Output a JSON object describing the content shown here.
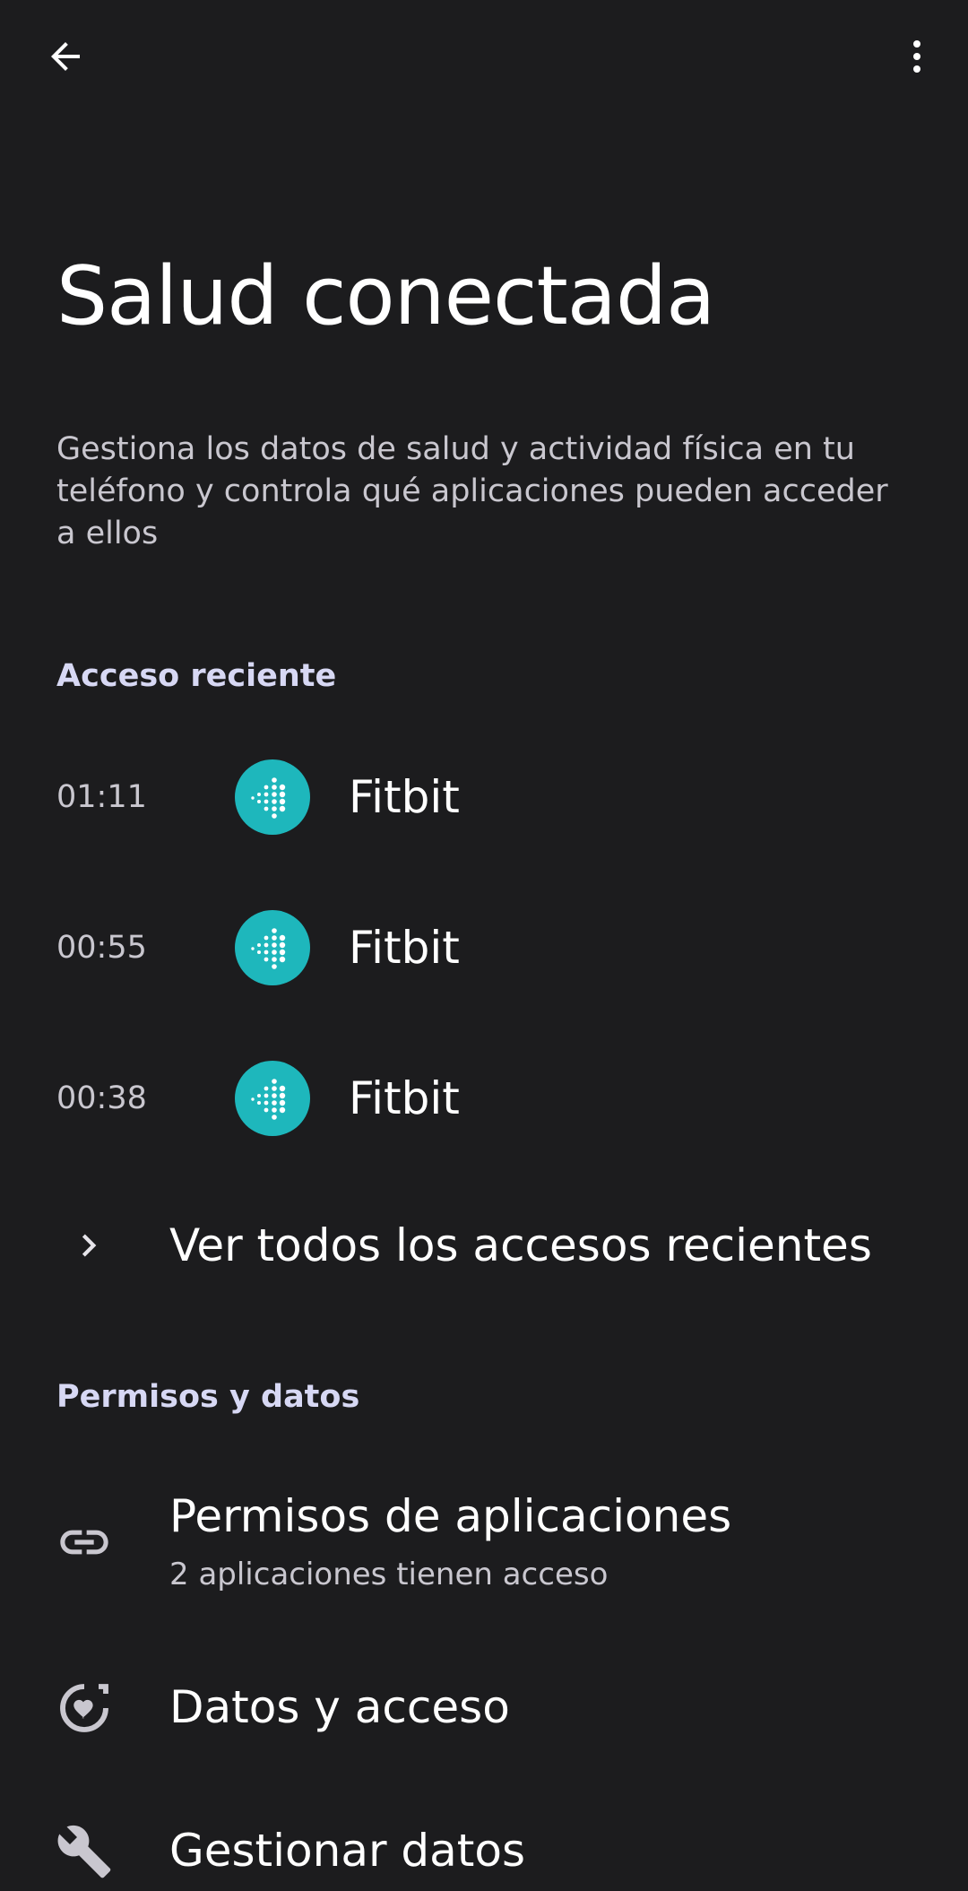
{
  "header": {
    "back_icon": "arrow-back-icon",
    "more_icon": "more-vert-icon"
  },
  "page": {
    "title": "Salud conectada",
    "description": "Gestiona los datos de salud y actividad física en tu teléfono y controla qué aplicaciones pueden acceder a ellos"
  },
  "recent_access": {
    "header": "Acceso reciente",
    "items": [
      {
        "time": "01:11",
        "app": "Fitbit",
        "icon": "fitbit-icon"
      },
      {
        "time": "00:55",
        "app": "Fitbit",
        "icon": "fitbit-icon"
      },
      {
        "time": "00:38",
        "app": "Fitbit",
        "icon": "fitbit-icon"
      }
    ],
    "see_all_label": "Ver todos los accesos recientes",
    "see_all_icon": "chevron-right-icon"
  },
  "permissions": {
    "header": "Permisos y datos",
    "items": [
      {
        "label": "Permisos de aplicaciones",
        "subtitle": "2 aplicaciones tienen acceso",
        "icon": "link-icon"
      },
      {
        "label": "Datos y acceso",
        "icon": "health-data-icon"
      },
      {
        "label": "Gestionar datos",
        "icon": "wrench-icon"
      }
    ]
  },
  "colors": {
    "background": "#1c1c1e",
    "fitbit_teal": "#1eb7bc",
    "section_header": "#d7d8f4"
  }
}
